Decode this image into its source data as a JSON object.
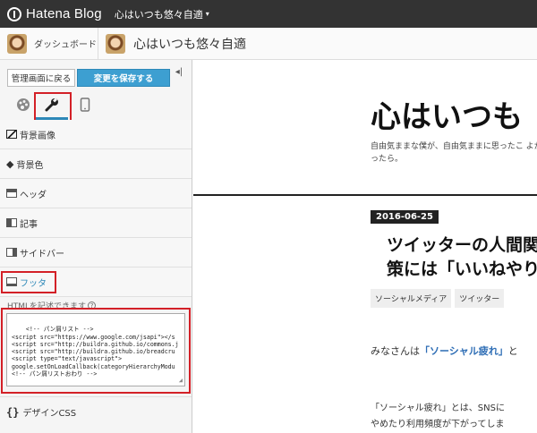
{
  "topbar": {
    "brand": "Hatena Blog",
    "blog_selector": "心はいつも悠々自適",
    "caret": "▾"
  },
  "subbar": {
    "dashboard": "ダッシュボード",
    "blog_title": "心はいつも悠々自適"
  },
  "panel": {
    "back_button": "管理画面に戻る",
    "save_button": "変更を保存する",
    "collapse": "◂|",
    "tabs": [
      {
        "icon": "palette-icon"
      },
      {
        "icon": "wrench-icon"
      },
      {
        "icon": "smartphone-icon"
      }
    ],
    "menu": [
      {
        "icon": "image-icon",
        "label": "背景画像"
      },
      {
        "icon": "color-icon",
        "label": "背景色"
      },
      {
        "icon": "header-icon",
        "label": "ヘッダ"
      },
      {
        "icon": "article-icon",
        "label": "記事"
      },
      {
        "icon": "sidebar-icon",
        "label": "サイドバー"
      },
      {
        "icon": "footer-icon",
        "label": "フッタ"
      }
    ],
    "hint": "HTMLを記述できます",
    "code": "<!-- パン屑リスト -->\n<script src=\"https://www.google.com/jsapi\"></s\n<script src=\"http://buildra.github.io/commons.j\n<script src=\"http://buildra.github.io/breadcru\n<script type=\"text/javascript\">\ngoogle.setOnLoadCallback(categoryHierarchyModu\n<!-- パン屑リストおわり -->",
    "design_css_icon": "{}",
    "design_css": "デザインCSS"
  },
  "preview": {
    "title": "心はいつも",
    "description": "自由気ままな僕が、自由気ままに思ったこ よかったら。",
    "date": "2016-06-25",
    "post_title_line1": "ツイッターの人間関",
    "post_title_line2": "策には「いいねやり",
    "tags": [
      "ソーシャルメディア",
      "ツイッター"
    ],
    "body_prefix": "みなさんは",
    "body_link": "「ソーシャル疲れ」",
    "body_suffix": "と",
    "body2_line1": "「ソーシャル疲れ」とは、SNSに",
    "body2_line2": "やめたり利用頻度が下がってしま"
  },
  "colors": {
    "accent": "#3d9fd1",
    "highlight": "#d32027",
    "topbar": "#333333"
  }
}
